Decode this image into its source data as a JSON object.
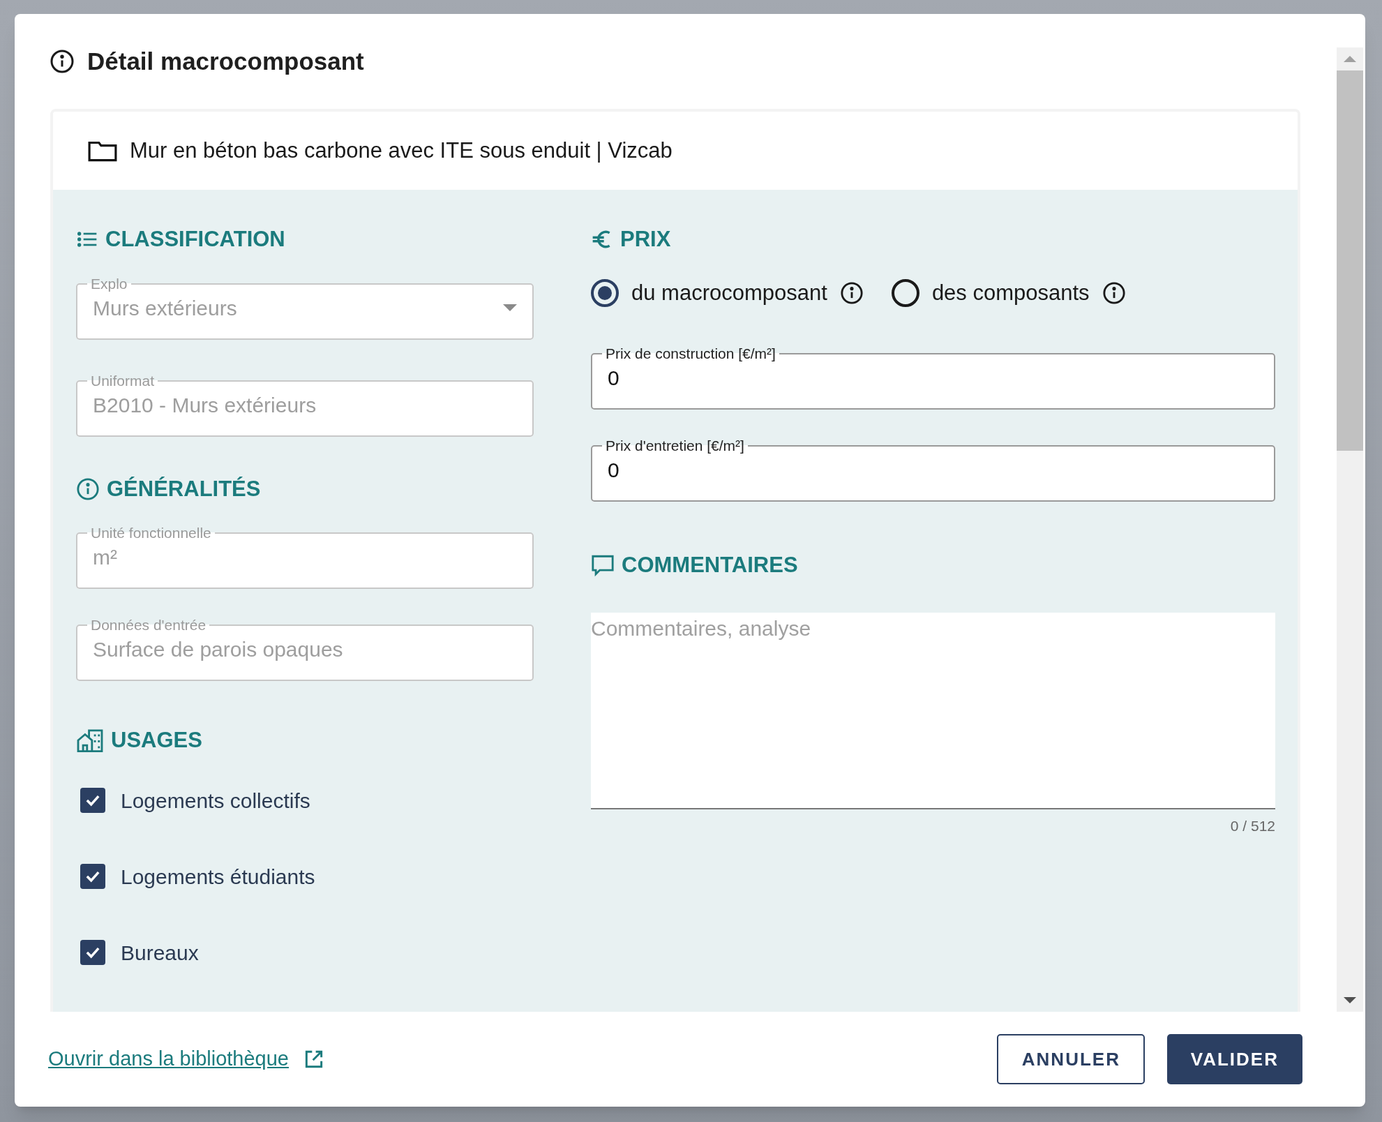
{
  "dialog": {
    "title": "Détail macrocomposant",
    "item_name": "Mur en béton bas carbone avec ITE sous enduit | Vizcab"
  },
  "classification": {
    "heading": "CLASSIFICATION",
    "fields": [
      {
        "kind": "select",
        "label": "Explo",
        "value": "Murs extérieurs",
        "disabled": true
      },
      {
        "label": "Uniformat",
        "value": "B2010 - Murs extérieurs",
        "disabled": true
      }
    ]
  },
  "generalites": {
    "heading": "GÉNÉRALITÉS",
    "fields": [
      {
        "label": "Unité fonctionnelle",
        "value": "m²",
        "disabled": true
      },
      {
        "label": "Données d'entrée",
        "value": "Surface de parois opaques",
        "disabled": true
      }
    ]
  },
  "usages": {
    "heading": "USAGES",
    "items": [
      {
        "label": "Logements collectifs",
        "checked": true
      },
      {
        "label": "Logements étudiants",
        "checked": true
      },
      {
        "label": "Bureaux",
        "checked": true
      }
    ]
  },
  "prix": {
    "heading": "PRIX",
    "options": [
      {
        "label": "du macrocomposant",
        "selected": true
      },
      {
        "label": "des composants",
        "selected": false
      }
    ],
    "fields": [
      {
        "label": "Prix de construction [€/m²]",
        "value": "0",
        "disabled": false
      },
      {
        "label": "Prix d'entretien [€/m²]",
        "value": "0",
        "disabled": false
      }
    ]
  },
  "commentaires": {
    "heading": "COMMENTAIRES",
    "placeholder": "Commentaires, analyse",
    "counter": "0 / 512"
  },
  "footer": {
    "link": "Ouvrir dans la bibliothèque",
    "buttons": [
      {
        "label": "ANNULER",
        "kind": "outlined"
      },
      {
        "label": "VALIDER",
        "kind": "primary"
      }
    ]
  }
}
